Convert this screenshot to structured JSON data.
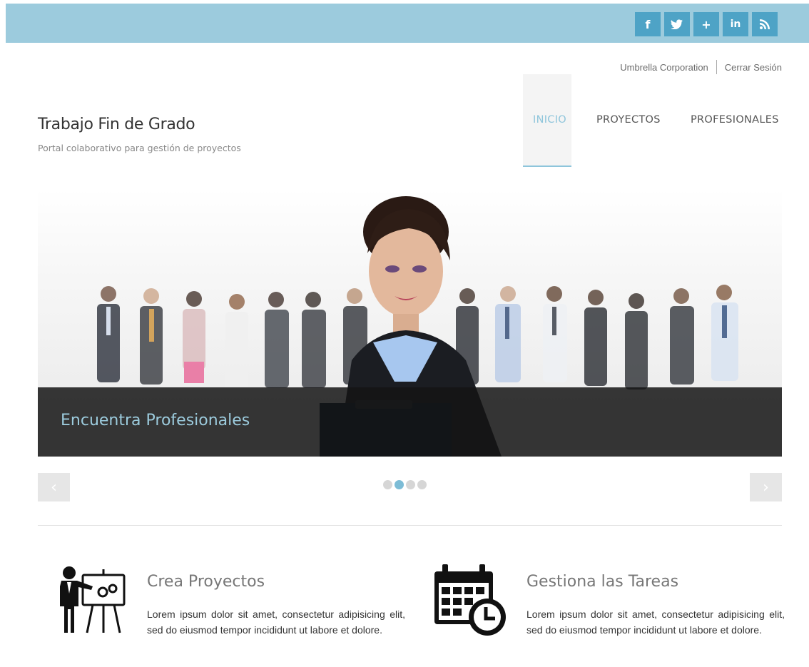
{
  "social": [
    {
      "icon": "facebook-icon",
      "glyph": "f"
    },
    {
      "icon": "twitter-icon",
      "glyph": "🐦"
    },
    {
      "icon": "google-plus-icon",
      "glyph": "+"
    },
    {
      "icon": "linkedin-icon",
      "glyph": "in"
    },
    {
      "icon": "rss-icon",
      "glyph": "☵"
    }
  ],
  "user": {
    "company": "Umbrella Corporation",
    "logout": "Cerrar Sesión"
  },
  "brand": {
    "title": "Trabajo Fin de Grado",
    "subtitle": "Portal colaborativo para gestión de proyectos"
  },
  "nav": {
    "inicio": "INICIO",
    "proyectos": "PROYECTOS",
    "profesionales": "PROFESIONALES"
  },
  "slider": {
    "caption": "Encuentra Profesionales",
    "prev": "‹",
    "next": "›",
    "active_slide": 2,
    "slide_count": 4
  },
  "features": [
    {
      "icon": "presentation-icon",
      "title": "Crea Proyectos",
      "text": "Lorem ipsum dolor sit amet, consectetur adipisicing elit, sed do eiusmod tempor incididunt ut labore et dolore."
    },
    {
      "icon": "calendar-clock-icon",
      "title": "Gestiona las Tareas",
      "text": "Lorem ipsum dolor sit amet, consectetur adipisicing elit, sed do eiusmod tempor incididunt ut labore et dolore."
    }
  ],
  "colors": {
    "topbar": "#9ccbdd",
    "social_button": "#4ea3c6",
    "accent": "#8ec5db",
    "caption_text": "#9ccbdd"
  }
}
